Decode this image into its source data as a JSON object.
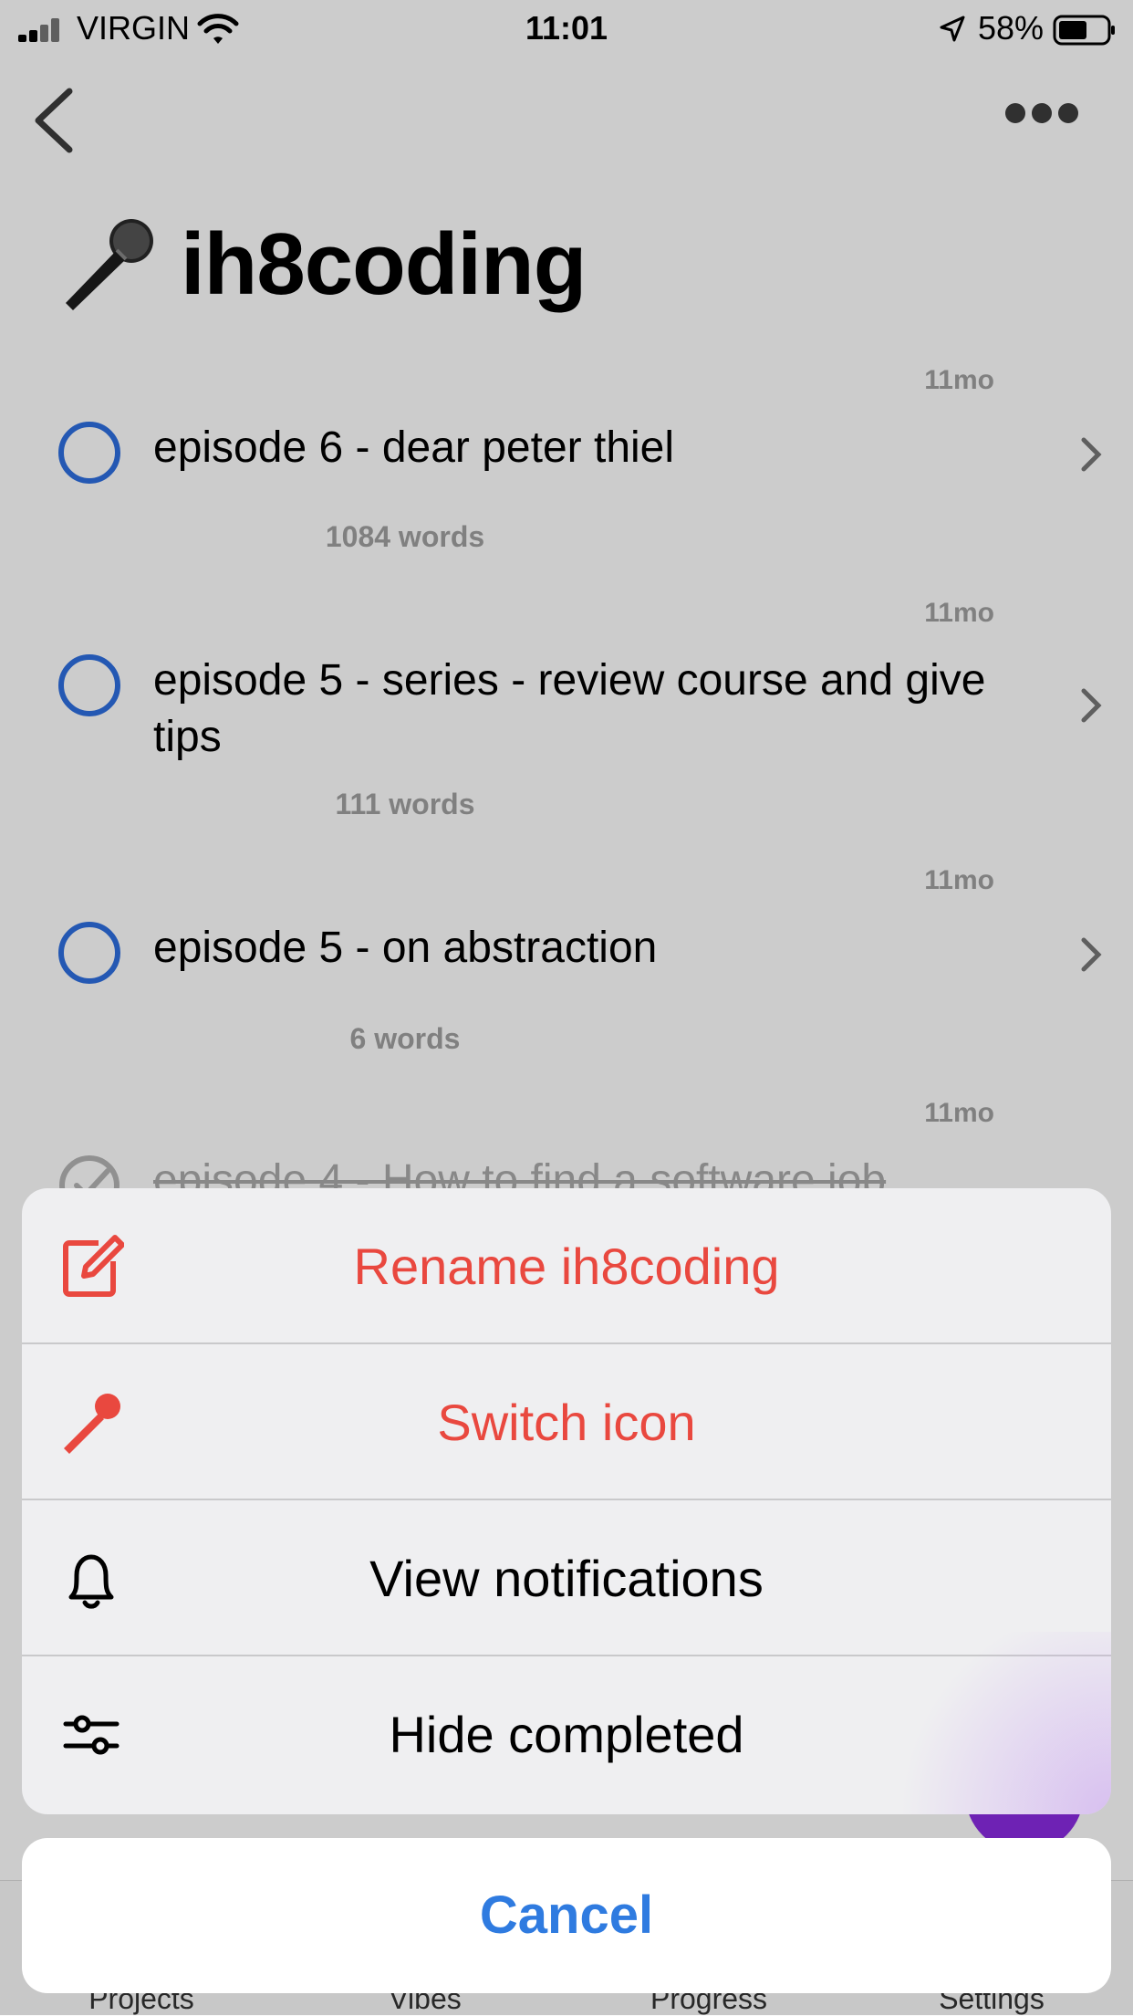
{
  "status_bar": {
    "carrier": "VIRGIN",
    "time": "11:01",
    "battery": "58%"
  },
  "project": {
    "title": "ih8coding",
    "icon": "microphone-icon"
  },
  "items": [
    {
      "title": "episode 6 - dear peter thiel",
      "words": "1084 words",
      "age": "11mo",
      "completed": false
    },
    {
      "title": "episode 5 - series - review course and give tips",
      "words": "111 words",
      "age": "11mo",
      "completed": false
    },
    {
      "title": "episode 5 - on abstraction",
      "words": "6 words",
      "age": "11mo",
      "completed": false
    },
    {
      "title": "episode 4 - How to find a software job",
      "words": "",
      "age": "11mo",
      "completed": true
    }
  ],
  "tabs": [
    "Projects",
    "Vibes",
    "Progress",
    "Settings"
  ],
  "action_sheet": {
    "rename_label": "Rename ih8coding",
    "switch_icon_label": "Switch icon",
    "view_notifications_label": "View notifications",
    "hide_completed_label": "Hide completed",
    "cancel_label": "Cancel"
  },
  "colors": {
    "accent_red": "#e9483f",
    "accent_blue": "#2f7be0",
    "circle_blue": "#2d6ee0",
    "fab_purple": "#8a2be2"
  }
}
